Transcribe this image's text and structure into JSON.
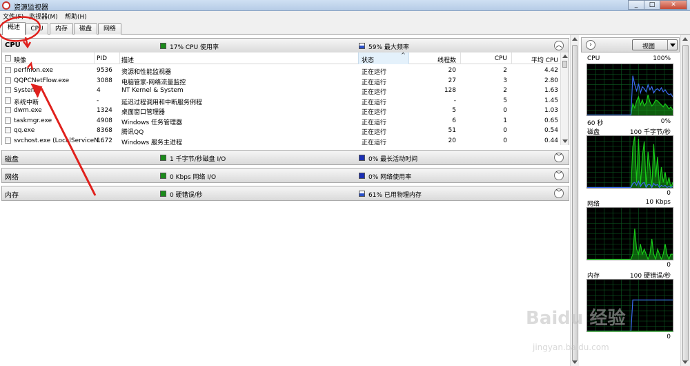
{
  "window": {
    "title": "资源监视器",
    "controls": [
      "_",
      "□",
      "✕"
    ]
  },
  "menu": {
    "items": [
      "文件(F)",
      "监视器(M)",
      "帮助(H)"
    ]
  },
  "tabs": [
    "概述",
    "CPU",
    "内存",
    "磁盘",
    "网络"
  ],
  "cpu": {
    "name": "CPU",
    "stat1": "17% CPU 使用率",
    "stat2": "59% 最大频率",
    "columns": [
      "映像",
      "PID",
      "描述",
      "状态",
      "线程数",
      "CPU",
      "平均 CPU"
    ],
    "rows": [
      [
        "perfmon.exe",
        "9536",
        "资源和性能监视器",
        "正在运行",
        "20",
        "2",
        "4.42"
      ],
      [
        "QQPCNetFlow.exe",
        "3088",
        "电脑管家-网络流量监控",
        "正在运行",
        "27",
        "3",
        "2.80"
      ],
      [
        "System",
        "4",
        "NT Kernel & System",
        "正在运行",
        "128",
        "2",
        "1.63"
      ],
      [
        "系统中断",
        "-",
        "延迟过程调用和中断服务例程",
        "正在运行",
        "-",
        "5",
        "1.45"
      ],
      [
        "dwm.exe",
        "1324",
        "桌面窗口管理器",
        "正在运行",
        "5",
        "0",
        "1.03"
      ],
      [
        "taskmgr.exe",
        "4908",
        "Windows 任务管理器",
        "正在运行",
        "6",
        "1",
        "0.65"
      ],
      [
        "qq.exe",
        "8368",
        "腾讯QQ",
        "正在运行",
        "51",
        "0",
        "0.54"
      ],
      [
        "svchost.exe (LocalServiceN...",
        "1672",
        "Windows 服务主进程",
        "正在运行",
        "20",
        "0",
        "0.44"
      ]
    ]
  },
  "disk": {
    "name": "磁盘",
    "stat1": "1 千字节/秒磁盘 I/O",
    "stat2": "0% 最长活动时间"
  },
  "network": {
    "name": "网络",
    "stat1": "0 Kbps 网络 I/O",
    "stat2": "0% 网络使用率"
  },
  "memory": {
    "name": "内存",
    "stat1": "0 硬错误/秒",
    "stat2": "61% 已用物理内存"
  },
  "right_panel": {
    "view_label": "视图",
    "cpu_label": "CPU",
    "cpu_max": "100%",
    "cpu_time": "60 秒",
    "cpu_min": "0%",
    "disk_label": "磁盘",
    "disk_max": "100 千字节/秒",
    "disk_min": "0",
    "net_label": "网络",
    "net_max": "10 Kbps",
    "net_min": "0",
    "mem_label": "内存",
    "mem_max": "100 硬错误/秒",
    "mem_min": "0"
  },
  "chart_data": [
    {
      "type": "line",
      "name_text": "CPU",
      "ylim": [
        0,
        100
      ],
      "series": [
        {
          "name": "CPU",
          "color": "#18c818",
          "values": [
            0,
            0,
            0,
            0,
            0,
            0,
            0,
            0,
            0,
            0,
            0,
            0,
            0,
            0,
            0,
            0,
            0,
            0,
            0,
            0,
            0,
            0,
            0,
            0,
            22,
            14,
            28,
            36,
            20,
            30,
            18,
            24,
            40,
            26,
            18,
            22,
            30,
            28,
            24,
            20,
            16,
            22,
            18,
            12,
            16,
            10
          ]
        },
        {
          "name": "最大频率",
          "color": "#3b6af0",
          "values": [
            0,
            0,
            0,
            0,
            0,
            0,
            0,
            0,
            0,
            0,
            0,
            0,
            0,
            0,
            0,
            0,
            0,
            0,
            0,
            0,
            0,
            0,
            0,
            0,
            78,
            60,
            48,
            62,
            44,
            56,
            52,
            46,
            60,
            50,
            56,
            44,
            50,
            52,
            48,
            54,
            46,
            50,
            44,
            40,
            42,
            36
          ]
        }
      ]
    },
    {
      "type": "line",
      "name_text": "磁盘",
      "ylim": [
        0,
        100
      ],
      "series": [
        {
          "name": "磁盘 I/O",
          "color": "#18c818",
          "values": [
            0,
            0,
            0,
            0,
            0,
            0,
            0,
            0,
            0,
            0,
            0,
            0,
            0,
            0,
            0,
            0,
            0,
            0,
            0,
            0,
            0,
            0,
            0,
            0,
            80,
            100,
            10,
            95,
            5,
            60,
            90,
            0,
            70,
            40,
            0,
            85,
            20,
            60,
            0,
            40,
            10,
            30,
            5,
            20,
            0,
            10
          ]
        },
        {
          "name": "最长活动时间",
          "color": "#3b6af0",
          "values": [
            0,
            0,
            0,
            0,
            0,
            0,
            0,
            0,
            0,
            0,
            0,
            0,
            0,
            0,
            0,
            0,
            0,
            0,
            0,
            0,
            0,
            0,
            0,
            0,
            8,
            10,
            4,
            12,
            2,
            8,
            10,
            0,
            6,
            6,
            0,
            8,
            4,
            6,
            0,
            4,
            2,
            4,
            0,
            2,
            0,
            2
          ]
        }
      ]
    },
    {
      "type": "line",
      "name_text": "网络",
      "ylim": [
        0,
        10
      ],
      "series": [
        {
          "name": "网络 I/O",
          "color": "#18c818",
          "values": [
            0,
            0,
            0,
            0,
            0,
            0,
            0,
            0,
            0,
            0,
            0,
            0,
            0,
            0,
            0,
            0,
            0,
            0,
            0,
            0,
            0,
            0,
            0,
            0,
            1,
            6,
            2,
            1,
            3,
            1,
            2,
            1,
            0,
            1,
            4,
            1,
            0,
            2,
            1,
            0,
            1,
            3,
            1,
            0,
            1,
            1
          ]
        }
      ]
    },
    {
      "type": "line",
      "name_text": "内存",
      "ylim": [
        0,
        100
      ],
      "series": [
        {
          "name": "已用物理内存",
          "color": "#3b6af0",
          "values": [
            0,
            0,
            0,
            0,
            0,
            0,
            0,
            0,
            0,
            0,
            0,
            0,
            0,
            0,
            0,
            0,
            0,
            0,
            0,
            0,
            0,
            0,
            0,
            0,
            61,
            61,
            61,
            61,
            61,
            61,
            61,
            61,
            61,
            61,
            61,
            61,
            61,
            61,
            61,
            61,
            61,
            61,
            61,
            61,
            61,
            61
          ]
        },
        {
          "name": "硬错误",
          "color": "#18c818",
          "values": [
            0,
            0,
            0,
            0,
            0,
            0,
            0,
            0,
            0,
            0,
            0,
            0,
            0,
            0,
            0,
            0,
            0,
            0,
            0,
            0,
            0,
            0,
            0,
            0,
            0,
            0,
            0,
            0,
            0,
            0,
            0,
            0,
            0,
            0,
            0,
            0,
            0,
            0,
            0,
            0,
            0,
            0,
            0,
            0,
            0,
            0
          ]
        }
      ]
    }
  ],
  "watermark": {
    "main": "Baidu 经验",
    "sub": "jingyan.baidu.com"
  },
  "annotation_color": "#e0201c"
}
